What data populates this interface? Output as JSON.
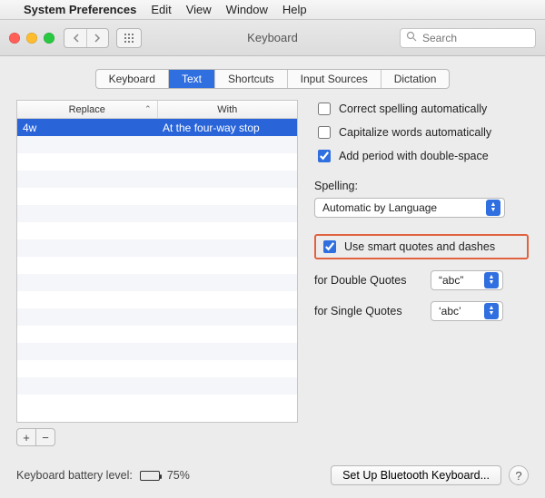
{
  "menubar": {
    "app": "System Preferences",
    "items": [
      "Edit",
      "View",
      "Window",
      "Help"
    ]
  },
  "toolbar": {
    "title": "Keyboard",
    "search_placeholder": "Search"
  },
  "tabs": {
    "items": [
      {
        "label": "Keyboard",
        "selected": false
      },
      {
        "label": "Text",
        "selected": true
      },
      {
        "label": "Shortcuts",
        "selected": false
      },
      {
        "label": "Input Sources",
        "selected": false
      },
      {
        "label": "Dictation",
        "selected": false
      }
    ]
  },
  "table": {
    "headers": {
      "replace": "Replace",
      "with": "With"
    },
    "rows": [
      {
        "replace": "4w",
        "with": "At the four-way stop",
        "selected": true
      }
    ]
  },
  "options": {
    "correct_spelling": {
      "label": "Correct spelling automatically",
      "checked": false
    },
    "capitalize": {
      "label": "Capitalize words automatically",
      "checked": false
    },
    "period": {
      "label": "Add period with double-space",
      "checked": true
    },
    "spelling_label": "Spelling:",
    "spelling_value": "Automatic by Language",
    "smart_quotes": {
      "label": "Use smart quotes and dashes",
      "checked": true,
      "highlighted": true
    },
    "double_quotes": {
      "label": "for Double Quotes",
      "value": "“abc”"
    },
    "single_quotes": {
      "label": "for Single Quotes",
      "value": "‘abc’"
    }
  },
  "footer": {
    "battery_label": "Keyboard battery level:",
    "battery_pct": "75%",
    "battery_fill_pct": 75,
    "setup_button": "Set Up Bluetooth Keyboard...",
    "help": "?"
  }
}
